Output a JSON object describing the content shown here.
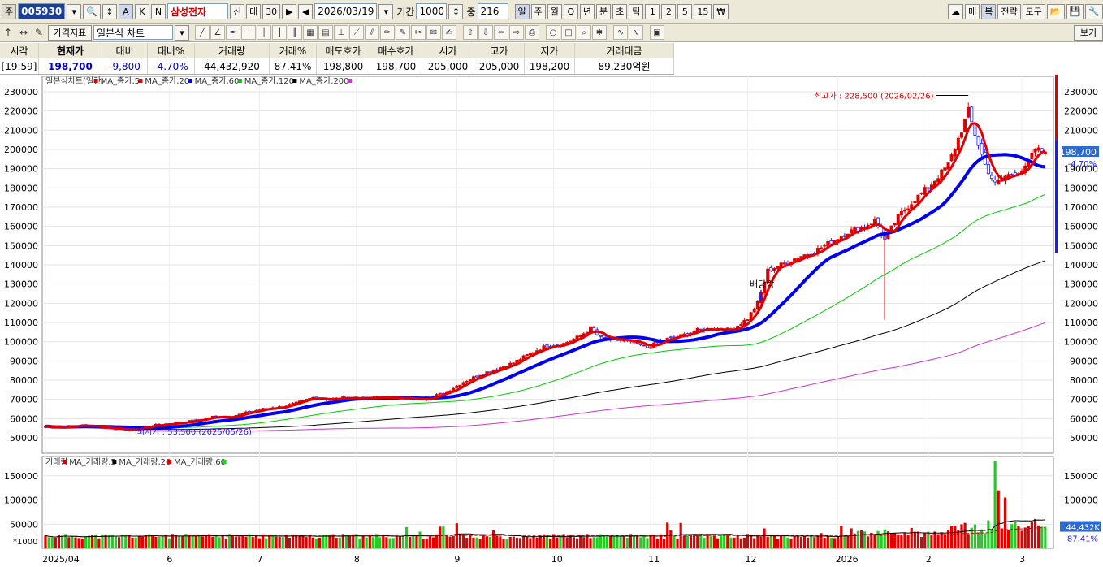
{
  "toolbar": {
    "type_label": "주",
    "code": "005930",
    "stock_name": "삼성전자",
    "date": "2026/03/19",
    "period_label": "기간",
    "period_value": "1000",
    "count_label": "중",
    "count_value": "216",
    "a_label": "A",
    "k_label": "K",
    "n_label": "N",
    "period_buttons": [
      "일",
      "주",
      "월",
      "Q",
      "년",
      "분",
      "초",
      "틱",
      "1",
      "2",
      "5",
      "15"
    ],
    "right_buttons": [
      "매",
      "복",
      "전략",
      "도구"
    ],
    "row2_price_indicator": "가격지표",
    "row2_chart_type": "일본식 차트",
    "row2_view": "보기"
  },
  "quote": {
    "headers": [
      "시각",
      "현재가",
      "대비",
      "대비%",
      "거래량",
      "거래%",
      "매도호가",
      "매수호가",
      "시가",
      "고가",
      "저가",
      "거래대금"
    ],
    "values": [
      "[19:59]",
      "198,700",
      "-9,800",
      "-4.70%",
      "44,432,920",
      "87.41%",
      "198,800",
      "198,700",
      "205,000",
      "205,000",
      "198,200",
      "89,230억원"
    ]
  },
  "chart_data": {
    "type": "candlestick",
    "legend_price": [
      "일본식차트(일간)",
      "MA_종가,5",
      "MA_종가,20",
      "MA_종가,60",
      "MA_종가,120",
      "MA_종가,200"
    ],
    "legend_volume": [
      "거래량",
      "MA_거래량,5",
      "MA_거래량,20",
      "MA_거래량,60"
    ],
    "colors": {
      "up": "#e00000",
      "down": "#1a1aff",
      "ma5": "#e00000",
      "ma20": "#0000ee",
      "ma60": "#00cc00",
      "ma120": "#000000",
      "ma200": "#cc33cc",
      "vol_up": "#e00000",
      "vol_down": "#22cc22"
    },
    "y_ticks": [
      230000,
      220000,
      210000,
      200000,
      190000,
      180000,
      170000,
      160000,
      150000,
      140000,
      130000,
      120000,
      110000,
      100000,
      90000,
      80000,
      70000,
      60000,
      50000
    ],
    "ylim": [
      42000,
      238000
    ],
    "vol_ticks": [
      150000,
      100000,
      50000
    ],
    "vol_ylim": [
      0,
      190000
    ],
    "vol_unit": "*1000",
    "x_ticks": [
      "2025/04",
      "6",
      "7",
      "8",
      "9",
      "10",
      "11",
      "12",
      "2026",
      "2",
      "3"
    ],
    "annotations": {
      "high": "최고가 : 228,500 (2026/02/26)",
      "low": "최저가 : 53,500 (2025/05/26)",
      "dividend": "배당락"
    },
    "current_price_label": "198,700",
    "current_change_label": "-4.70%",
    "current_volume_label": "44,432K",
    "current_volume_ratio_label": "87.41%",
    "price_anchors": [
      [
        0,
        56000
      ],
      [
        5,
        55500
      ],
      [
        10,
        56500
      ],
      [
        15,
        56000
      ],
      [
        20,
        55000
      ],
      [
        25,
        54000
      ],
      [
        30,
        56000
      ],
      [
        35,
        57000
      ],
      [
        40,
        58000
      ],
      [
        45,
        59000
      ],
      [
        50,
        61000
      ],
      [
        55,
        61000
      ],
      [
        60,
        63000
      ],
      [
        65,
        65000
      ],
      [
        70,
        66000
      ],
      [
        75,
        68000
      ],
      [
        80,
        71000
      ],
      [
        85,
        70000
      ],
      [
        90,
        71000
      ],
      [
        95,
        70500
      ],
      [
        100,
        71000
      ],
      [
        105,
        71000
      ],
      [
        110,
        70000
      ],
      [
        115,
        71000
      ],
      [
        120,
        74000
      ],
      [
        125,
        79000
      ],
      [
        130,
        83000
      ],
      [
        135,
        86000
      ],
      [
        140,
        89000
      ],
      [
        145,
        94000
      ],
      [
        150,
        98000
      ],
      [
        155,
        99000
      ],
      [
        160,
        103000
      ],
      [
        163,
        107000
      ],
      [
        166,
        102000
      ],
      [
        170,
        101000
      ],
      [
        175,
        100000
      ],
      [
        180,
        97000
      ],
      [
        185,
        101000
      ],
      [
        190,
        103000
      ],
      [
        195,
        106000
      ],
      [
        200,
        107000
      ],
      [
        205,
        106000
      ],
      [
        210,
        112000
      ],
      [
        213,
        120000
      ],
      [
        216,
        137000
      ],
      [
        220,
        140000
      ],
      [
        225,
        144000
      ],
      [
        230,
        147000
      ],
      [
        235,
        152000
      ],
      [
        240,
        157000
      ],
      [
        245,
        160000
      ],
      [
        248,
        163000
      ],
      [
        251,
        153000
      ],
      [
        255,
        165000
      ],
      [
        260,
        174000
      ],
      [
        265,
        182000
      ],
      [
        270,
        192000
      ],
      [
        274,
        210000
      ],
      [
        276,
        220000
      ],
      [
        278,
        208000
      ],
      [
        281,
        192000
      ],
      [
        284,
        182000
      ],
      [
        287,
        186000
      ],
      [
        290,
        188000
      ],
      [
        293,
        190000
      ],
      [
        296,
        200000
      ],
      [
        299,
        198700
      ]
    ],
    "last_index": 299
  }
}
